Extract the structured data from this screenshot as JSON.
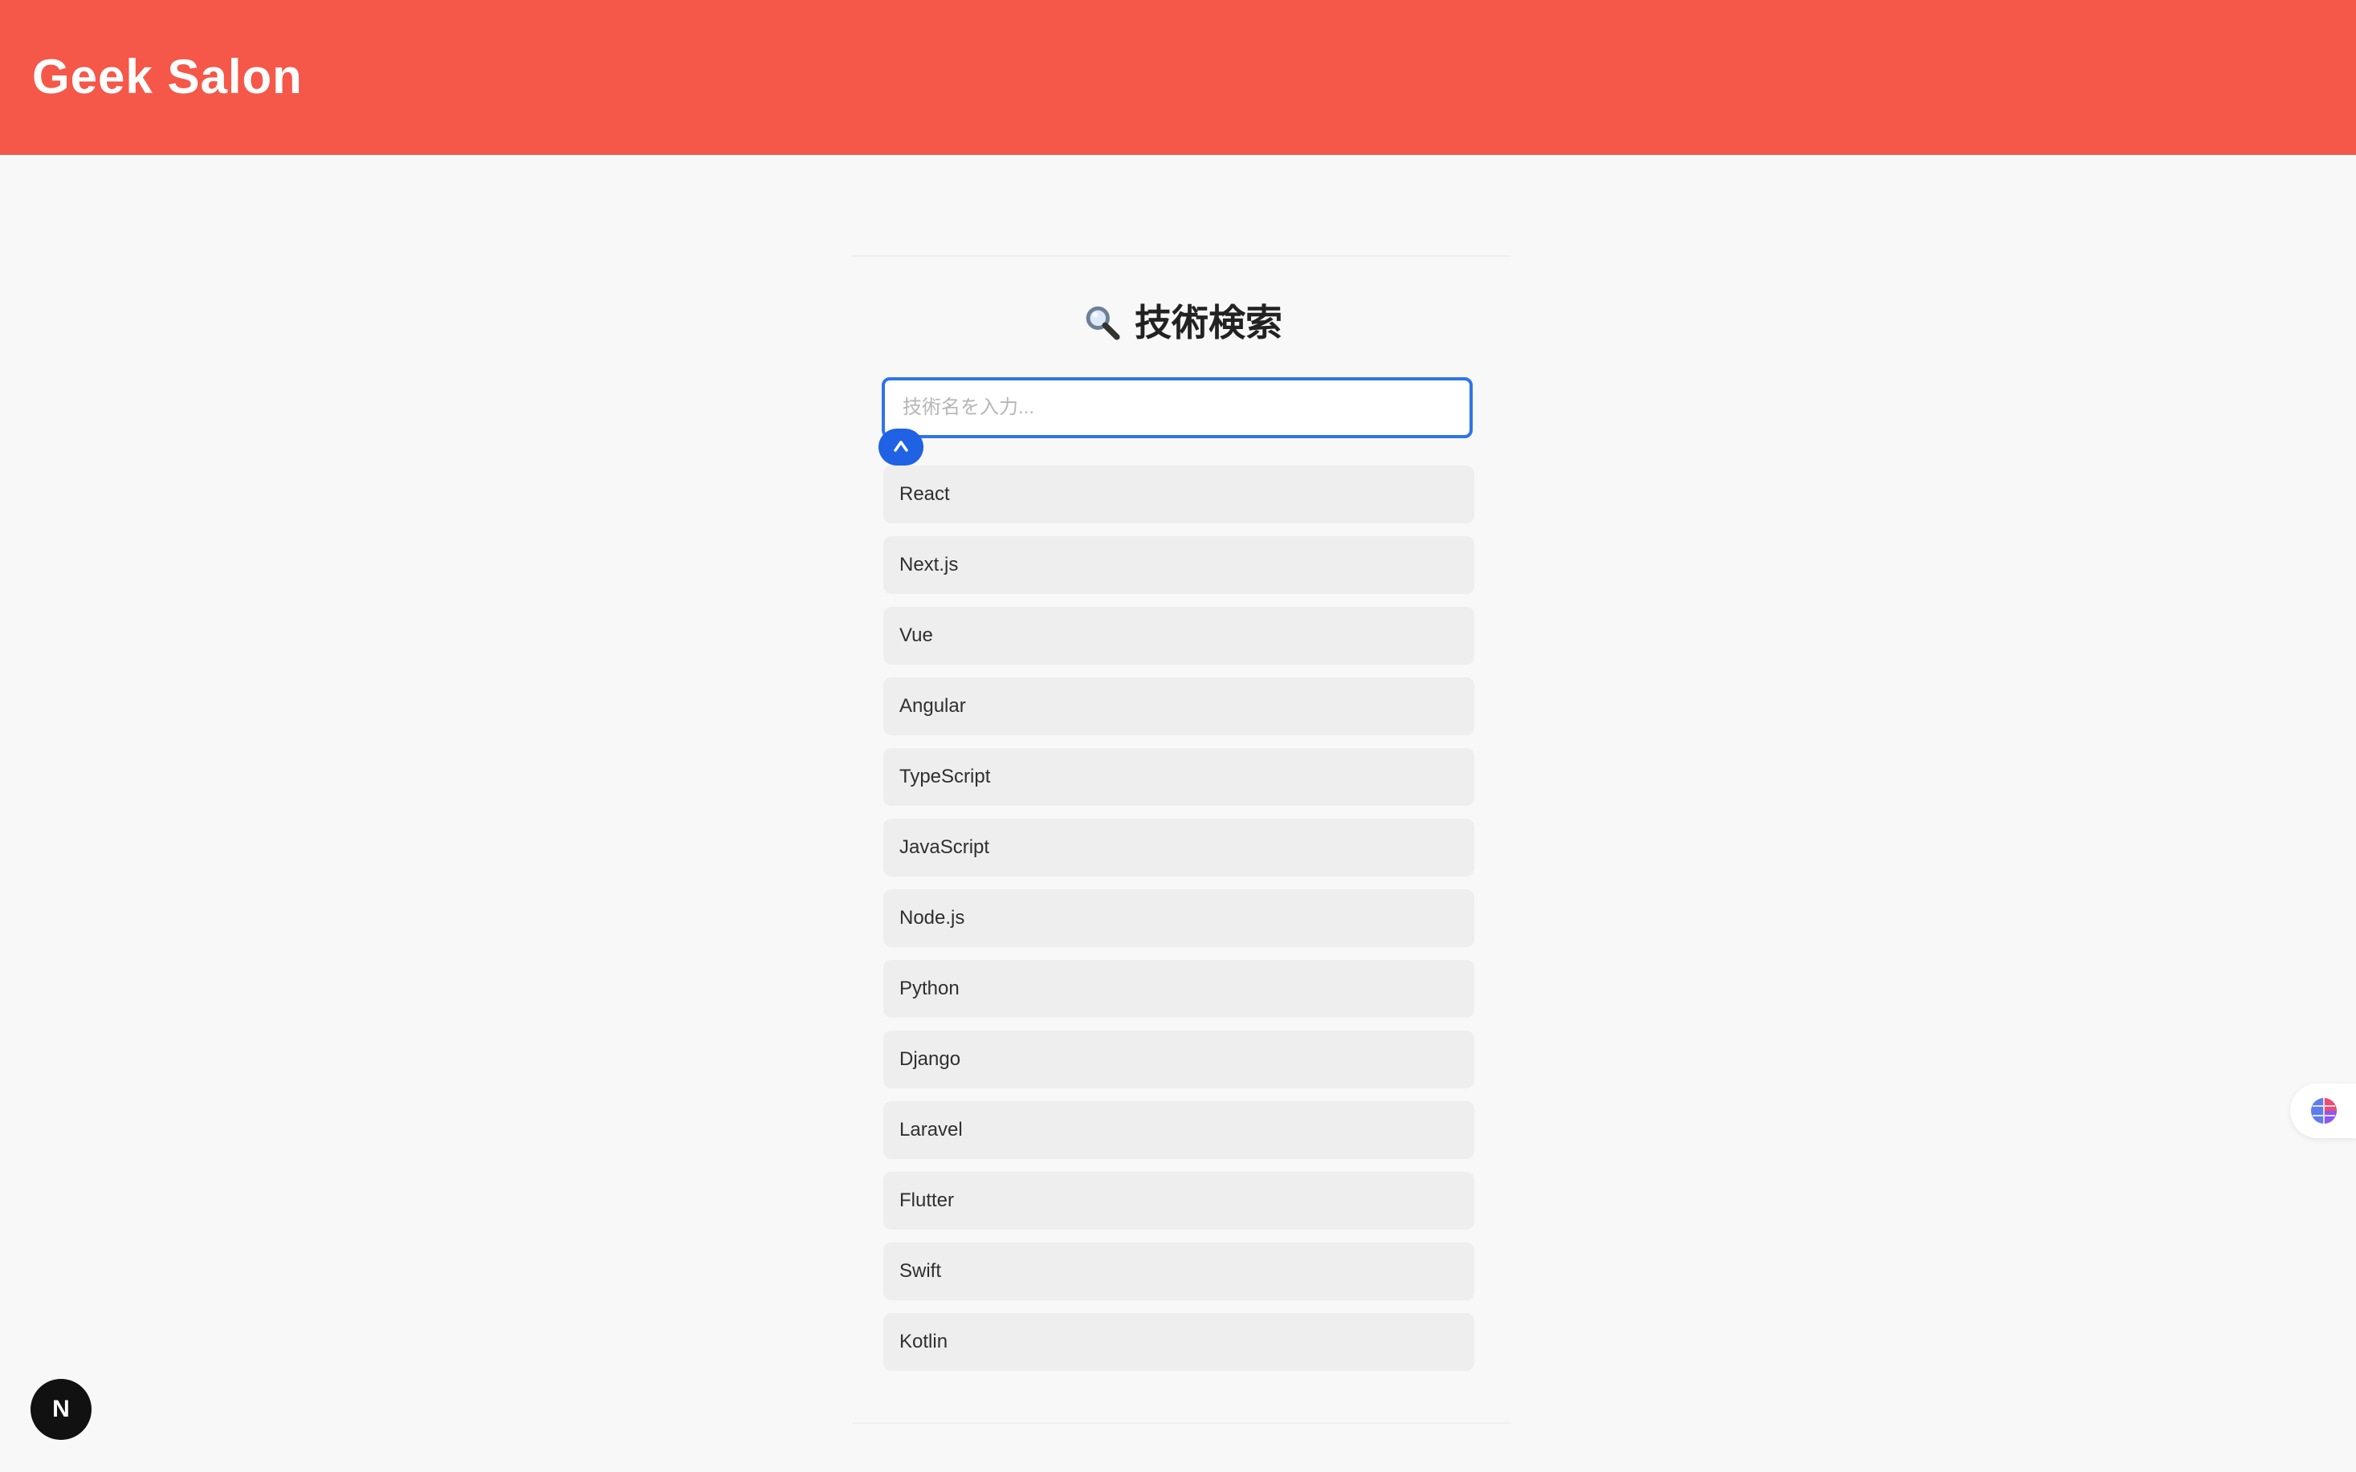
{
  "app": {
    "brand": "Geek Salon"
  },
  "search": {
    "title": "技術検索",
    "placeholder": "技術名を入力...",
    "value": ""
  },
  "results": [
    {
      "label": "React"
    },
    {
      "label": "Next.js"
    },
    {
      "label": "Vue"
    },
    {
      "label": "Angular"
    },
    {
      "label": "TypeScript"
    },
    {
      "label": "JavaScript"
    },
    {
      "label": "Node.js"
    },
    {
      "label": "Python"
    },
    {
      "label": "Django"
    },
    {
      "label": "Laravel"
    },
    {
      "label": "Flutter"
    },
    {
      "label": "Swift"
    },
    {
      "label": "Kotlin"
    }
  ],
  "colors": {
    "header_background": "#f55748",
    "page_background": "#f8f8f8",
    "input_border": "#2f74ea",
    "list_item_background": "#eeeeee"
  },
  "icons": {
    "search": "magnifier-icon",
    "grammar_badge": "grammar-assistant-icon",
    "floating_widget": "colorful-globe-icon",
    "next_badge": "nextjs-icon"
  },
  "dev_badge": {
    "label": "N"
  }
}
